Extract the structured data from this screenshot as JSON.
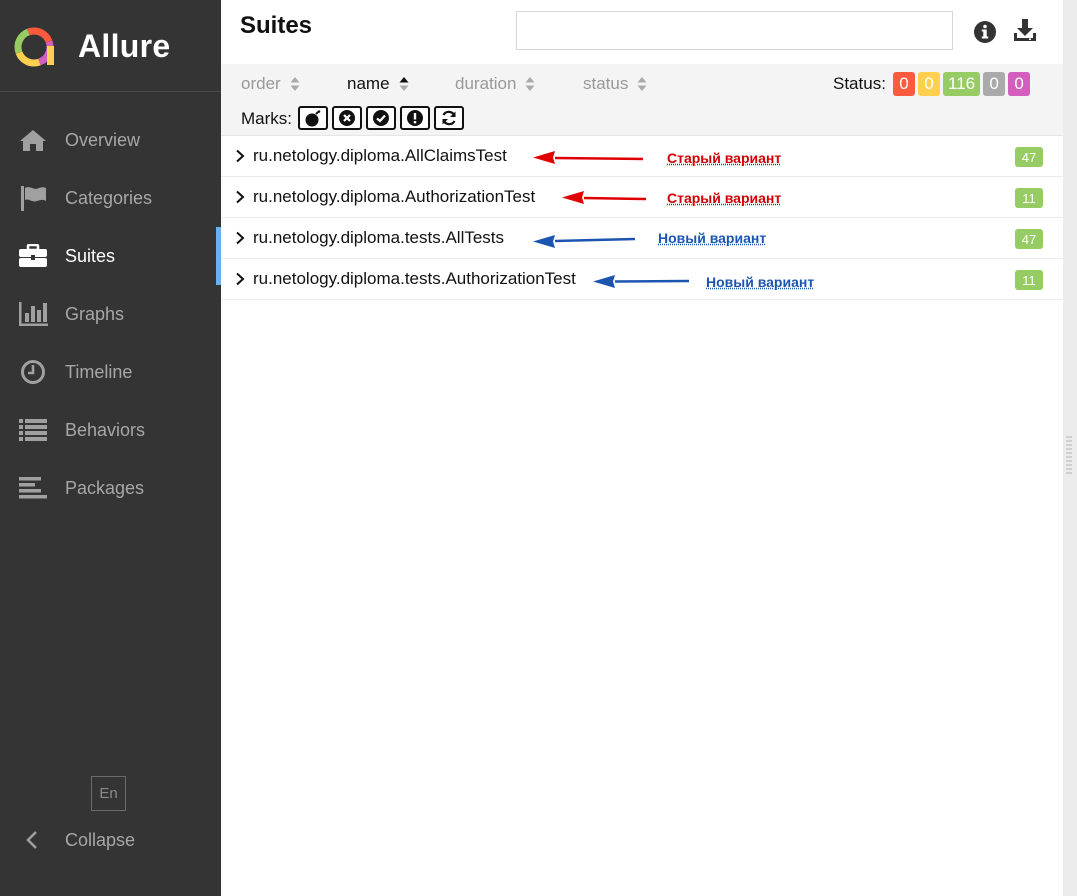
{
  "brand": {
    "name": "Allure"
  },
  "sidebar": {
    "items": [
      {
        "label": "Overview",
        "icon": "home-icon"
      },
      {
        "label": "Categories",
        "icon": "flag-icon"
      },
      {
        "label": "Suites",
        "icon": "briefcase-icon",
        "active": true
      },
      {
        "label": "Graphs",
        "icon": "bar-chart-icon"
      },
      {
        "label": "Timeline",
        "icon": "clock-icon"
      },
      {
        "label": "Behaviors",
        "icon": "list-icon"
      },
      {
        "label": "Packages",
        "icon": "align-left-icon"
      }
    ],
    "language": "En",
    "collapse_label": "Collapse"
  },
  "main": {
    "title": "Suites",
    "search": {
      "value": "",
      "placeholder": ""
    },
    "toolbar": {
      "sorters": [
        {
          "label": "order",
          "active": false
        },
        {
          "label": "name",
          "active": true
        },
        {
          "label": "duration",
          "active": false
        },
        {
          "label": "status",
          "active": false
        }
      ],
      "status_label": "Status:",
      "status_badges": [
        {
          "value": "0",
          "status": "failed",
          "color": "#fd5a3e"
        },
        {
          "value": "0",
          "status": "broken",
          "color": "#ffd050"
        },
        {
          "value": "116",
          "status": "passed",
          "color": "#97cc64"
        },
        {
          "value": "0",
          "status": "skipped",
          "color": "#aaaaaa"
        },
        {
          "value": "0",
          "status": "unknown",
          "color": "#d35ebe"
        }
      ],
      "marks_label": "Marks:",
      "marks": [
        "flaky-bomb-icon",
        "new-failed-icon",
        "new-passed-icon",
        "new-broken-icon",
        "retries-icon"
      ]
    },
    "rows": [
      {
        "name": "ru.netology.diploma.AllClaimsTest",
        "count": "47"
      },
      {
        "name": "ru.netology.diploma.AuthorizationTest",
        "count": "11"
      },
      {
        "name": "ru.netology.diploma.tests.AllTests",
        "count": "47"
      },
      {
        "name": "ru.netology.diploma.tests.AuthorizationTest",
        "count": "11"
      }
    ],
    "annotations": [
      {
        "text": "Старый вариант",
        "color": "#d10000"
      },
      {
        "text": "Старый вариант",
        "color": "#d10000"
      },
      {
        "text": "Новый вариант",
        "color": "#1c55b0"
      },
      {
        "text": "Новый вариант",
        "color": "#1c55b0"
      }
    ]
  }
}
